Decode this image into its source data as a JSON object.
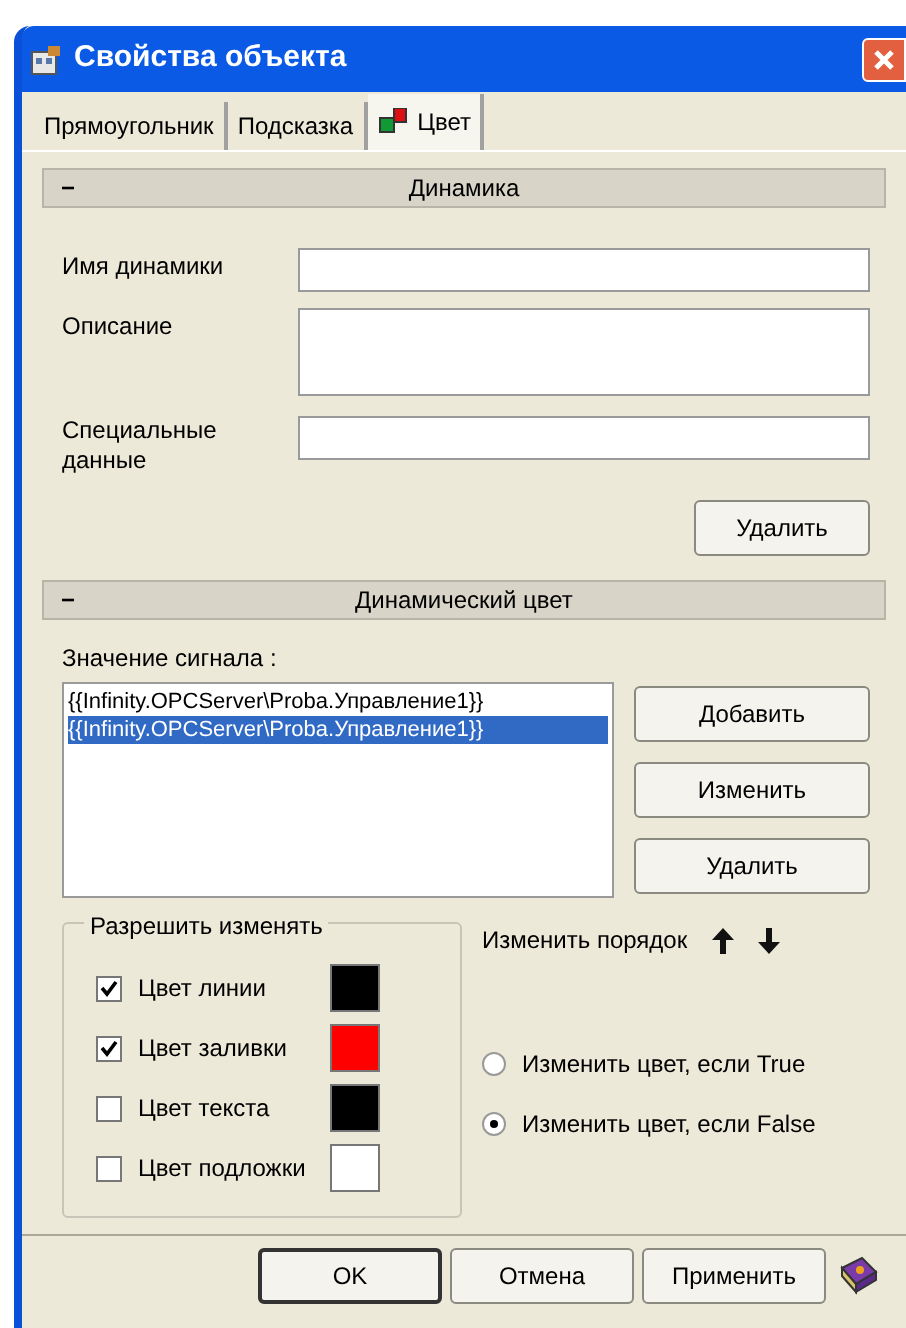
{
  "window": {
    "title": "Свойства объекта"
  },
  "tabs": [
    {
      "label": "Прямоугольник",
      "selected": false,
      "kind": "text"
    },
    {
      "label": "Подсказка",
      "selected": false,
      "kind": "text"
    },
    {
      "label": "Цвет",
      "selected": true,
      "kind": "icon"
    }
  ],
  "dynamics": {
    "toggle": "−",
    "title": "Динамика",
    "fields": [
      {
        "label": "Имя динамики",
        "kind": "line"
      },
      {
        "label": "Описание",
        "kind": "multi"
      },
      {
        "label": "Специальные данные",
        "kind": "line"
      }
    ],
    "delete_button": "Удалить"
  },
  "dynamic_color": {
    "toggle": "−",
    "title": "Динамический цвет",
    "signal_label": "Значение сигнала :",
    "signals": [
      {
        "text": "{{Infinity.OPCServer\\Proba.Управление1}}",
        "selected": false
      },
      {
        "text": "{{Infinity.OPCServer\\Proba.Управление1}}",
        "selected": true
      }
    ],
    "buttons": [
      "Добавить",
      "Изменить",
      "Удалить"
    ],
    "allow_group": {
      "title": "Разрешить изменять",
      "items": [
        {
          "label": "Цвет линии",
          "checked": true,
          "color": "#000000"
        },
        {
          "label": "Цвет заливки",
          "checked": true,
          "color": "#ff0000"
        },
        {
          "label": "Цвет текста",
          "checked": false,
          "color": "#000000"
        },
        {
          "label": "Цвет подложки",
          "checked": false,
          "color": "#ffffff"
        }
      ]
    },
    "order_label": "Изменить порядок",
    "conditions": [
      {
        "label": "Изменить цвет, если True",
        "selected": false
      },
      {
        "label": "Изменить цвет, если False",
        "selected": true
      }
    ]
  },
  "footer_buttons": [
    {
      "label": "OK",
      "default": true
    },
    {
      "label": "Отмена",
      "default": false
    },
    {
      "label": "Применить",
      "default": false
    }
  ]
}
